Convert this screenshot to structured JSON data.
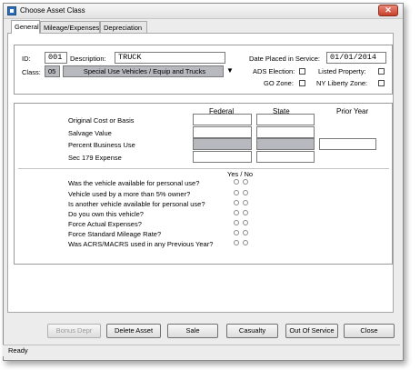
{
  "window": {
    "title": "Choose Asset Class",
    "close_glyph": "✕"
  },
  "tabs": [
    {
      "label": "General"
    },
    {
      "label": "Mileage/Expenses"
    },
    {
      "label": "Depreciation"
    }
  ],
  "asset": {
    "id_label": "ID:",
    "id_value": "001",
    "description_label": "Description:",
    "description_value": "TRUCK",
    "date_label": "Date Placed in Service:",
    "date_value": "01/01/2014",
    "class_label": "Class:",
    "class_code": "05",
    "class_name": "Special Use Vehicles / Equip and Trucks",
    "class_dropdown_glyph": "▼",
    "checkboxes": [
      {
        "label": "ADS Election:",
        "checked": false
      },
      {
        "label": "Listed Property:",
        "checked": false
      },
      {
        "label": "GO Zone:",
        "checked": false
      },
      {
        "label": "NY Liberty Zone:",
        "checked": false
      }
    ]
  },
  "basis": {
    "columns": [
      "Federal",
      "State",
      "Prior Year"
    ],
    "rows": [
      {
        "label": "Original Cost or Basis"
      },
      {
        "label": "Salvage Value"
      },
      {
        "label": "Percent Business Use"
      },
      {
        "label": "Sec 179 Expense"
      }
    ]
  },
  "questions": {
    "header": "Yes / No",
    "items": [
      "Was the vehicle available for personal use?",
      "Vehicle used by a more than 5% owner?",
      "Is another vehicle available for personal use?",
      "Do you own this vehicle?",
      "Force Actual Expenses?",
      "Force Standard Mileage Rate?",
      "Was ACRS/MACRS used in any Previous Year?"
    ]
  },
  "buttons": {
    "bonus": "Bonus Depr",
    "delete": "Delete Asset",
    "sale": "Sale",
    "casualty": "Casualty",
    "out_of_service": "Out Of Service",
    "close": "Close"
  },
  "status": {
    "text": "Ready"
  }
}
